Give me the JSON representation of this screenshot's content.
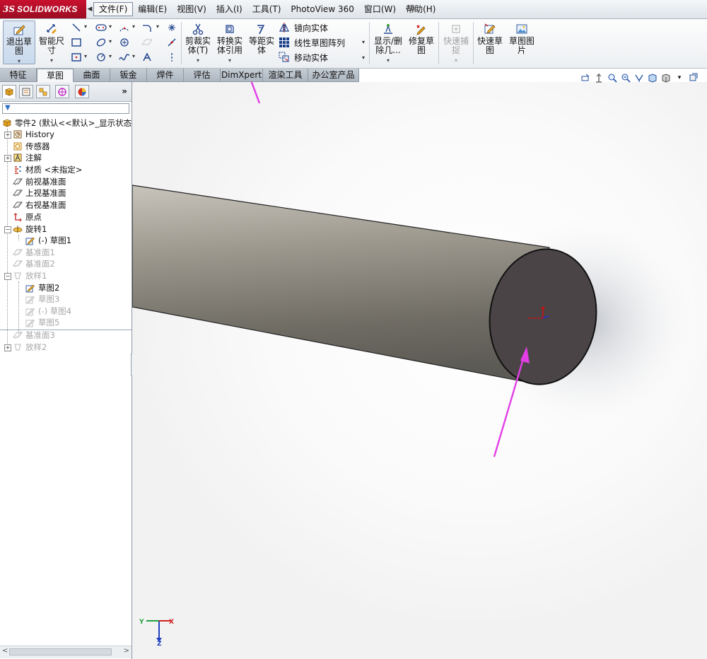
{
  "app": {
    "brand": "SOLIDWORKS",
    "brand_prefix": "3S"
  },
  "menu": [
    {
      "label": "文件(F)",
      "active": true
    },
    {
      "label": "编辑(E)"
    },
    {
      "label": "视图(V)"
    },
    {
      "label": "插入(I)"
    },
    {
      "label": "工具(T)"
    },
    {
      "label": "PhotoView 360"
    },
    {
      "label": "窗口(W)"
    },
    {
      "label": "帮助(H)"
    }
  ],
  "commands": {
    "exit_sketch": "退出草\n图",
    "smart_dim": "智能尺\n寸",
    "trim": "剪裁实\n体(T)",
    "convert": "转换实\n体引用",
    "offset": "等距实\n体",
    "mirror": "镜向实体",
    "linear_pattern": "线性草图阵列",
    "move": "移动实体",
    "show_delete": "显示/删\n除几...",
    "repair": "修复草\n图",
    "quick_snap": "快速捕\n捉",
    "quick_sketch": "快速草\n图",
    "sketch_picture": "草图图\n片"
  },
  "tabs": [
    {
      "label": "特征"
    },
    {
      "label": "草图",
      "active": true
    },
    {
      "label": "曲面"
    },
    {
      "label": "钣金"
    },
    {
      "label": "焊件"
    },
    {
      "label": "评估"
    },
    {
      "label": "DimXpert"
    },
    {
      "label": "渲染工具"
    },
    {
      "label": "办公室产品"
    }
  ],
  "tree": {
    "root": "零件2  (默认<<默认>_显示状态",
    "items": [
      {
        "label": "History"
      },
      {
        "label": "传感器"
      },
      {
        "label": "注解"
      },
      {
        "label": "材质 <未指定>"
      },
      {
        "label": "前视基准面"
      },
      {
        "label": "上视基准面"
      },
      {
        "label": "右视基准面"
      },
      {
        "label": "原点"
      },
      {
        "label": "旋转1"
      },
      {
        "label": "(-) 草图1"
      },
      {
        "label": "基准面1"
      },
      {
        "label": "基准面2"
      },
      {
        "label": "放样1"
      },
      {
        "label": "草图2"
      },
      {
        "label": "草图3"
      },
      {
        "label": "(-) 草图4"
      },
      {
        "label": "草图5"
      },
      {
        "label": "基准面3"
      },
      {
        "label": "放样2"
      }
    ]
  },
  "triad": {
    "x": "X",
    "y": "Y",
    "z": "Z"
  },
  "colors": {
    "annotation_arrow": "#e23ee6",
    "cylinder_face": "#4a4446",
    "cylinder_body": "#8f8b82"
  }
}
